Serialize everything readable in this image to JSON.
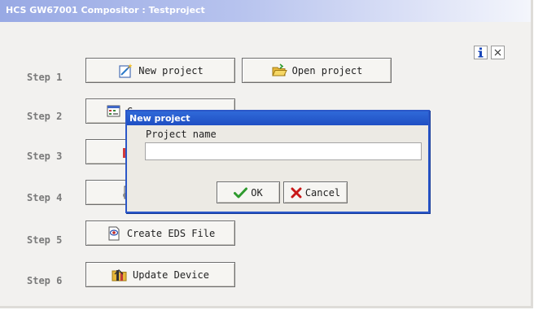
{
  "window": {
    "title": "HCS GW67001 Compositor : Testproject",
    "info_button_label": "i",
    "close_button_label": "×"
  },
  "steps": [
    {
      "label": "Step 1",
      "buttons": [
        {
          "label": "New project",
          "icon": "new-project-icon"
        },
        {
          "label": "Open project",
          "icon": "folder-open-icon"
        }
      ]
    },
    {
      "label": "Step 2",
      "buttons": [
        {
          "label": "G",
          "icon": "configuration-icon"
        }
      ]
    },
    {
      "label": "Step 3",
      "buttons": []
    },
    {
      "label": "Step 4",
      "buttons": []
    },
    {
      "label": "Step 5",
      "buttons": [
        {
          "label": "Create EDS File",
          "icon": "eds-file-icon"
        }
      ]
    },
    {
      "label": "Step 6",
      "buttons": [
        {
          "label": "Update Device",
          "icon": "update-device-icon"
        }
      ]
    }
  ],
  "dialog": {
    "title": "New project",
    "field_label": "Project name",
    "field_value": "",
    "ok_label": "OK",
    "cancel_label": "Cancel"
  },
  "colors": {
    "title_gradient_start": "#98a9e4",
    "dialog_title_blue": "#1f4fc3",
    "ok_check_green": "#2e9a2e",
    "cancel_x_red": "#c81818"
  }
}
